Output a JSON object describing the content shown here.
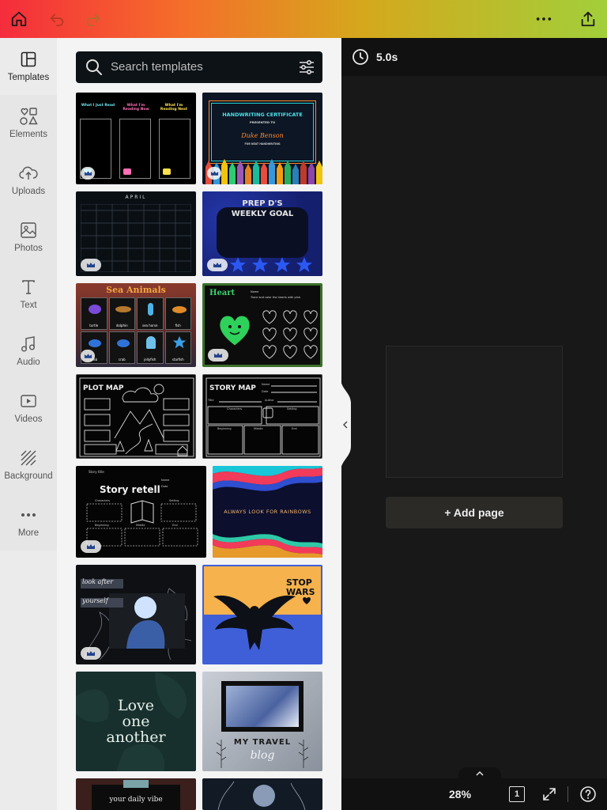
{
  "rail": {
    "items": [
      {
        "label": "Templates",
        "icon": "templates-icon"
      },
      {
        "label": "Elements",
        "icon": "elements-icon"
      },
      {
        "label": "Uploads",
        "icon": "uploads-icon"
      },
      {
        "label": "Photos",
        "icon": "photos-icon"
      },
      {
        "label": "Text",
        "icon": "text-icon"
      },
      {
        "label": "Audio",
        "icon": "audio-icon"
      },
      {
        "label": "Videos",
        "icon": "videos-icon"
      },
      {
        "label": "Background",
        "icon": "background-icon"
      },
      {
        "label": "More",
        "icon": "more-icon"
      }
    ]
  },
  "search": {
    "placeholder": "Search templates"
  },
  "templates": {
    "t1": {
      "h1": "What I Just Read",
      "h2": "What I'm Reading Now",
      "h3": "What I'm Reading Next"
    },
    "t2": {
      "title": "HANDWRITING CERTIFICATE",
      "sub": "PRESENTED TO",
      "name": "Duke Benson",
      "line": "FOR NEAT HANDWRITING"
    },
    "t3": {
      "month": "APRIL"
    },
    "t4": {
      "title1": "PREP D'S",
      "title2": "WEEKLY GOAL"
    },
    "t5": {
      "title": "Sea Animals",
      "a1": "turtle",
      "a2": "dolphin",
      "a3": "sea horse",
      "a4": "fish",
      "a5": "crab",
      "a6": "crab",
      "a7": "jellyfish",
      "a8": "starfish"
    },
    "t6": {
      "title": "Heart",
      "name": "Name",
      "instr": "Trace and color the hearts with pink."
    },
    "t7": {
      "title": "PLOT MAP"
    },
    "t8": {
      "title": "STORY MAP",
      "name": "Name",
      "date": "Date",
      "title_f": "Title",
      "author": "Author",
      "characters": "Characters",
      "setting": "Setting",
      "beginning": "Beginning",
      "middle": "Middle",
      "end": "End"
    },
    "t9": {
      "topline": "Story title",
      "title": "Story retell",
      "characters": "Characters",
      "setting": "Setting",
      "beginning": "Beginning",
      "middle": "Middle",
      "end": "End",
      "name": "Name",
      "date": "Date"
    },
    "t10": {
      "title": "ALWAYS LOOK FOR RAINBOWS"
    },
    "t11": {
      "l1": "look after",
      "l2": "yourself"
    },
    "t12": {
      "l1": "STOP",
      "l2": "WARS"
    },
    "t13": {
      "l1": "Love",
      "l2": "one",
      "l3": "another"
    },
    "t14": {
      "l1": "MY TRAVEL",
      "l2": "blog"
    },
    "t15": {
      "l1": "your daily vibe"
    }
  },
  "timebar": {
    "duration": "5.0s"
  },
  "canvas": {
    "add_page": "+ Add page"
  },
  "bottom": {
    "zoom": "28%",
    "page_count": "1"
  },
  "colors": {
    "accent_gradient_start": "#f52c3c",
    "accent_gradient_end": "#a2cf3a",
    "panel_bg": "#f4f4f4",
    "canvas_bg": "#181818"
  }
}
